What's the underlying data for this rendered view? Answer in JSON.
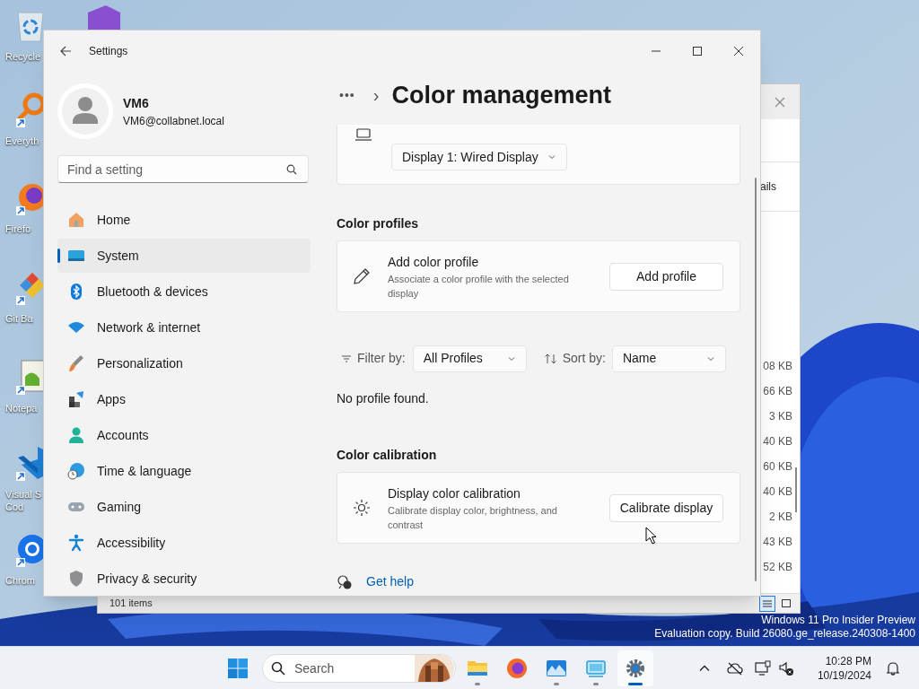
{
  "desktop_icons": [
    {
      "label": "Recycle"
    },
    {
      "label": "Everyth"
    },
    {
      "label": "Firefo"
    },
    {
      "label": "Git Ba"
    },
    {
      "label": "Notepa"
    },
    {
      "label": "Visual S\nCod"
    },
    {
      "label": "Chrom"
    }
  ],
  "explorer_window": {
    "column_heading": "ails",
    "sizes": [
      "08 KB",
      "66 KB",
      "3 KB",
      "40 KB",
      "60 KB",
      "40 KB",
      "2 KB",
      "43 KB",
      "52 KB"
    ],
    "status": "101 items",
    "views": [
      {
        "selected": true
      },
      {
        "selected": false
      }
    ]
  },
  "settings_window": {
    "title": "Settings",
    "user": {
      "name": "VM6",
      "email": "VM6@collabnet.local"
    },
    "search": {
      "placeholder": "Find a setting"
    },
    "nav": [
      {
        "label": "Home",
        "selected": false
      },
      {
        "label": "System",
        "selected": true
      },
      {
        "label": "Bluetooth & devices",
        "selected": false
      },
      {
        "label": "Network & internet",
        "selected": false
      },
      {
        "label": "Personalization",
        "selected": false
      },
      {
        "label": "Apps",
        "selected": false
      },
      {
        "label": "Accounts",
        "selected": false
      },
      {
        "label": "Time & language",
        "selected": false
      },
      {
        "label": "Gaming",
        "selected": false
      },
      {
        "label": "Accessibility",
        "selected": false
      },
      {
        "label": "Privacy & security",
        "selected": false
      }
    ],
    "breadcrumb": {
      "overflow": "•••",
      "separator": "›",
      "title": "Color management"
    },
    "display_select": "Display 1: Wired Display",
    "color_profiles": {
      "heading": "Color profiles",
      "title": "Add color profile",
      "description": "Associate a color profile with the selected display",
      "button": "Add profile"
    },
    "filter": {
      "label": "Filter by:",
      "value": "All Profiles"
    },
    "sort": {
      "label": "Sort by:",
      "value": "Name"
    },
    "empty_message": "No profile found.",
    "color_calibration": {
      "heading": "Color calibration",
      "title": "Display color calibration",
      "description": "Calibrate display color, brightness, and contrast",
      "button": "Calibrate display"
    },
    "help_link": "Get help"
  },
  "os_notice": [
    "Windows 11 Pro Insider Preview",
    "Evaluation copy. Build 26080.ge_release.240308-1400"
  ],
  "taskbar": {
    "search_placeholder": "Search",
    "apps": [
      {
        "running": true,
        "selected": false
      },
      {
        "running": false,
        "selected": false
      },
      {
        "running": true,
        "selected": false
      },
      {
        "running": true,
        "selected": false
      },
      {
        "running": true,
        "selected": true
      }
    ],
    "time": "10:28 PM",
    "date": "10/19/2024"
  }
}
